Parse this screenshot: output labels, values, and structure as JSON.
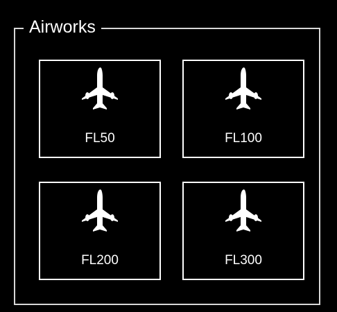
{
  "group": {
    "title": "Airworks"
  },
  "tiles": [
    {
      "label": "FL50",
      "icon": "airplane-icon"
    },
    {
      "label": "FL100",
      "icon": "airplane-icon"
    },
    {
      "label": "FL200",
      "icon": "airplane-icon"
    },
    {
      "label": "FL300",
      "icon": "airplane-icon"
    }
  ],
  "colors": {
    "background": "#000000",
    "border": "#ffffff",
    "text": "#ffffff"
  }
}
